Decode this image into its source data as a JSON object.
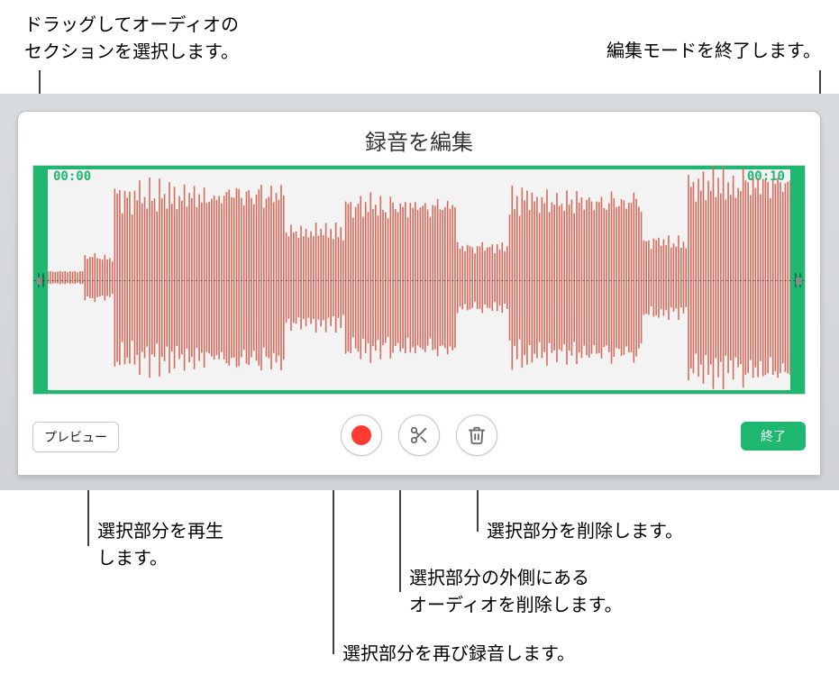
{
  "callouts": {
    "drag_select": "ドラッグしてオーディオの\nセクションを選択します。",
    "exit_edit": "編集モードを終了します。",
    "play_selection": "選択部分を再生\nします。",
    "delete_selection": "選択部分を削除します。",
    "trim_outside": "選択部分の外側にある\nオーディオを削除します。",
    "rerecord_selection": "選択部分を再び録音します。"
  },
  "panel": {
    "title": "録音を編集",
    "time_start": "00:00",
    "time_end": "00:10"
  },
  "toolbar": {
    "preview_label": "プレビュー",
    "done_label": "終了"
  },
  "icons": {
    "record": "record-icon",
    "scissors": "scissors-icon",
    "trash": "trash-icon"
  },
  "colors": {
    "accent_green": "#1eb871",
    "waveform": "#d56a5a",
    "record_red": "#ff3b30"
  }
}
